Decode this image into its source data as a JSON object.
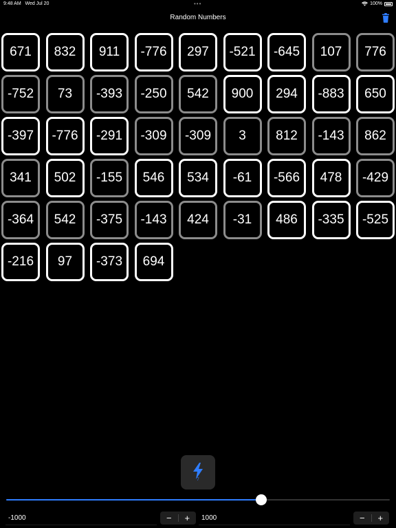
{
  "status": {
    "time": "9:48 AM",
    "date": "Wed Jul 20",
    "battery": "100%"
  },
  "nav": {
    "title": "Random Numbers"
  },
  "tiles": [
    {
      "v": "671",
      "g": false
    },
    {
      "v": "832",
      "g": false
    },
    {
      "v": "911",
      "g": false
    },
    {
      "v": "-776",
      "g": false
    },
    {
      "v": "297",
      "g": false
    },
    {
      "v": "-521",
      "g": false
    },
    {
      "v": "-645",
      "g": false
    },
    {
      "v": "107",
      "g": true
    },
    {
      "v": "776",
      "g": true
    },
    {
      "v": "-752",
      "g": true
    },
    {
      "v": "73",
      "g": true
    },
    {
      "v": "-393",
      "g": true
    },
    {
      "v": "-250",
      "g": true
    },
    {
      "v": "542",
      "g": true
    },
    {
      "v": "900",
      "g": false
    },
    {
      "v": "294",
      "g": false
    },
    {
      "v": "-883",
      "g": false
    },
    {
      "v": "650",
      "g": false
    },
    {
      "v": "-397",
      "g": false
    },
    {
      "v": "-776",
      "g": false
    },
    {
      "v": "-291",
      "g": false
    },
    {
      "v": "-309",
      "g": true
    },
    {
      "v": "-309",
      "g": true
    },
    {
      "v": "3",
      "g": true
    },
    {
      "v": "812",
      "g": true
    },
    {
      "v": "-143",
      "g": true
    },
    {
      "v": "862",
      "g": true
    },
    {
      "v": "341",
      "g": true
    },
    {
      "v": "502",
      "g": false
    },
    {
      "v": "-155",
      "g": true
    },
    {
      "v": "546",
      "g": false
    },
    {
      "v": "534",
      "g": false
    },
    {
      "v": "-61",
      "g": false
    },
    {
      "v": "-566",
      "g": false
    },
    {
      "v": "478",
      "g": false
    },
    {
      "v": "-429",
      "g": true
    },
    {
      "v": "-364",
      "g": true
    },
    {
      "v": "542",
      "g": true
    },
    {
      "v": "-375",
      "g": true
    },
    {
      "v": "-143",
      "g": true
    },
    {
      "v": "424",
      "g": true
    },
    {
      "v": "-31",
      "g": true
    },
    {
      "v": "486",
      "g": false
    },
    {
      "v": "-335",
      "g": false
    },
    {
      "v": "-525",
      "g": false
    },
    {
      "v": "-216",
      "g": false
    },
    {
      "v": "97",
      "g": false
    },
    {
      "v": "-373",
      "g": false
    },
    {
      "v": "694",
      "g": false
    }
  ],
  "generate_button": {
    "count": "7"
  },
  "slider": {
    "value_fraction": 0.664
  },
  "min_field": {
    "value": "-1000"
  },
  "max_field": {
    "value": "1000"
  },
  "stepper": {
    "minus": "−",
    "plus": "+"
  },
  "colors": {
    "accent": "#2f7dff",
    "tile_active": "#ffffff",
    "tile_dim": "#8c8c8c"
  }
}
